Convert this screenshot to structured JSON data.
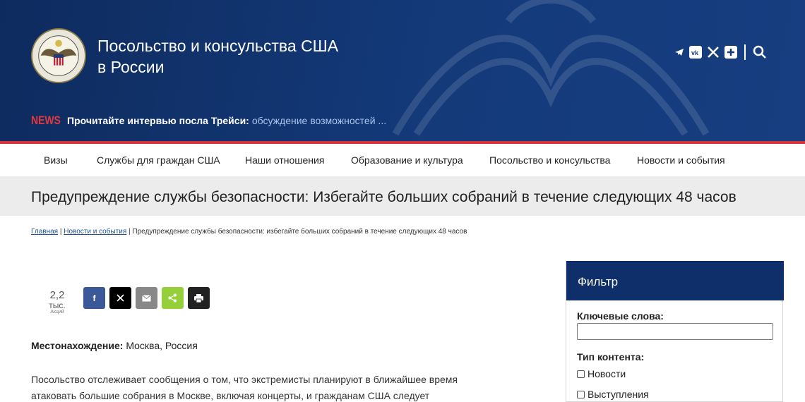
{
  "header": {
    "title_line1": "Посольство и консульства США",
    "title_line2": "в России",
    "social_icons": [
      "telegram-icon",
      "vk-icon",
      "x-icon",
      "plus-icon",
      "search-icon"
    ]
  },
  "news": {
    "label": "NEWS",
    "strong": "Прочитайте интервью посла Трейси:",
    "link": "обсуждение возможностей ..."
  },
  "nav": {
    "items": [
      "Визы",
      "Службы для граждан США",
      "Наши отношения",
      "Образование и культура",
      "Посольство и консульства",
      "Новости и события"
    ]
  },
  "page": {
    "title": "Предупреждение службы безопасности: Избегайте больших собраний в течение следующих 48 часов"
  },
  "breadcrumb": {
    "home": "Главная",
    "sep": " | ",
    "news": "Новости и события",
    "current": "Предупреждение службы безопасности: избегайте больших собраний в течение следующих 48 часов"
  },
  "share": {
    "count": "2,2",
    "unit": "тыс.",
    "word": "Акций",
    "buttons": [
      {
        "name": "facebook-share-button",
        "icon": "facebook-icon",
        "color": "#3b5998"
      },
      {
        "name": "x-share-button",
        "icon": "x-icon",
        "color": "#000000"
      },
      {
        "name": "email-share-button",
        "icon": "email-icon",
        "color": "#888888"
      },
      {
        "name": "sharethis-share-button",
        "icon": "share-icon",
        "color": "#95d03a"
      },
      {
        "name": "print-share-button",
        "icon": "print-icon",
        "color": "#222222"
      }
    ]
  },
  "article": {
    "location_label": "Местонахождение:",
    "location_value": " Москва, Россия",
    "body_line1": "Посольство отслеживает сообщения о том, что экстремисты планируют в ближайшее время",
    "body_line2": "атаковать большие собрания в Москве, включая концерты, и гражданам США следует"
  },
  "filter": {
    "title": "Фильтр",
    "keywords_label": "Ключевые слова:",
    "keywords_value": "",
    "content_type_label": "Тип контента:",
    "options": [
      "Новости",
      "Выступления"
    ]
  },
  "colors": {
    "header_blue": "#102f66",
    "accent_red": "#d9323a",
    "filter_blue": "#0e2f6a"
  }
}
